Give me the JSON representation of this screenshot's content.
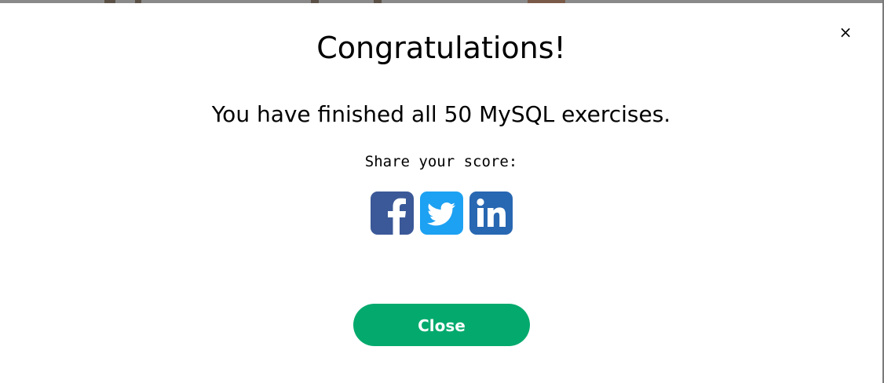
{
  "dialog": {
    "close_glyph": "×",
    "title": "Congratulations!",
    "message": "You have finished all 50 MySQL exercises.",
    "share_label": "Share your score:",
    "share_buttons": [
      {
        "network": "facebook",
        "icon": "facebook-icon",
        "color": "#3b5998"
      },
      {
        "network": "twitter",
        "icon": "twitter-icon",
        "color": "#1da1f2"
      },
      {
        "network": "linkedin",
        "icon": "linkedin-icon",
        "color": "#2867b2"
      }
    ],
    "close_button_label": "Close",
    "close_button_color": "#04aa6d"
  }
}
